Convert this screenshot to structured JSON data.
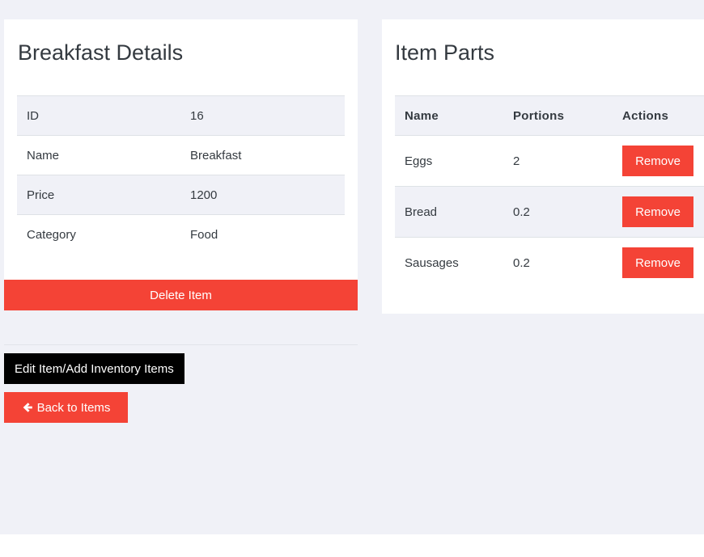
{
  "details": {
    "title": "Breakfast Details",
    "rows": [
      {
        "label": "ID",
        "value": "16"
      },
      {
        "label": "Name",
        "value": "Breakfast"
      },
      {
        "label": "Price",
        "value": "1200"
      },
      {
        "label": "Category",
        "value": "Food"
      }
    ],
    "delete_label": "Delete Item"
  },
  "parts": {
    "title": "Item Parts",
    "headers": {
      "name": "Name",
      "portions": "Portions",
      "actions": "Actions"
    },
    "rows": [
      {
        "name": "Eggs",
        "portions": "2",
        "action": "Remove"
      },
      {
        "name": "Bread",
        "portions": "0.2",
        "action": "Remove"
      },
      {
        "name": "Sausages",
        "portions": "0.2",
        "action": "Remove"
      }
    ]
  },
  "actions": {
    "edit_label": "Edit Item/Add Inventory Items",
    "back_label": "Back to Items",
    "back_icon": "arrow-left-icon"
  },
  "colors": {
    "danger": "#f44336",
    "dark": "#000000",
    "page_bg": "#f0f1f7",
    "text": "#343a40"
  }
}
